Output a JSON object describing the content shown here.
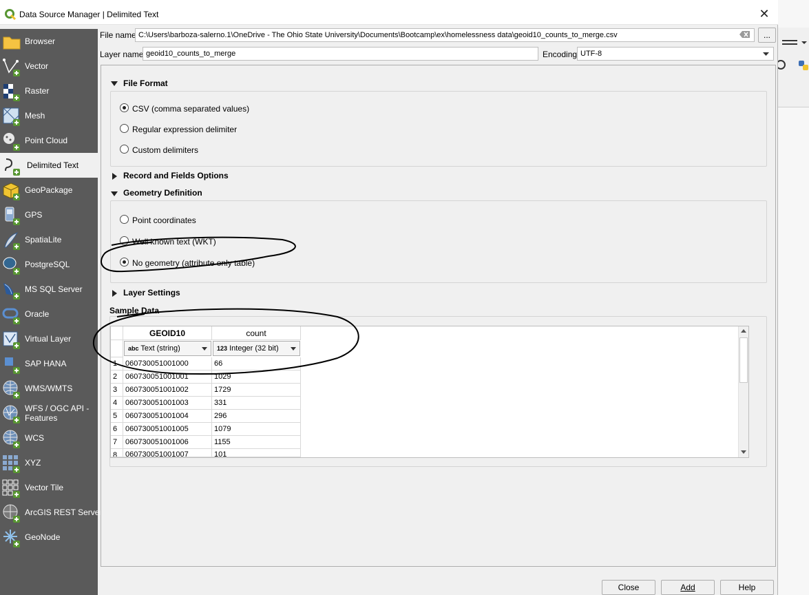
{
  "window": {
    "title": "Data Source Manager | Delimited Text",
    "close_glyph": "✕"
  },
  "sidebar": {
    "items": [
      {
        "label": "Browser",
        "icon": "folder-icon"
      },
      {
        "label": "Vector",
        "icon": "vector-icon"
      },
      {
        "label": "Raster",
        "icon": "raster-icon"
      },
      {
        "label": "Mesh",
        "icon": "mesh-icon"
      },
      {
        "label": "Point Cloud",
        "icon": "point-cloud-icon"
      },
      {
        "label": "Delimited Text",
        "icon": "delimited-text-icon",
        "active": true
      },
      {
        "label": "GeoPackage",
        "icon": "geopackage-icon"
      },
      {
        "label": "GPS",
        "icon": "gps-icon"
      },
      {
        "label": "SpatiaLite",
        "icon": "spatialite-icon"
      },
      {
        "label": "PostgreSQL",
        "icon": "postgresql-icon"
      },
      {
        "label": "MS SQL Server",
        "icon": "mssql-icon"
      },
      {
        "label": "Oracle",
        "icon": "oracle-icon"
      },
      {
        "label": "Virtual Layer",
        "icon": "virtual-layer-icon"
      },
      {
        "label": "SAP HANA",
        "icon": "sap-hana-icon"
      },
      {
        "label": "WMS/WMTS",
        "icon": "wms-icon"
      },
      {
        "label_line1": "WFS / OGC API -",
        "label_line2": "Features",
        "icon": "wfs-icon"
      },
      {
        "label": "WCS",
        "icon": "wcs-icon"
      },
      {
        "label": "XYZ",
        "icon": "xyz-icon"
      },
      {
        "label": "Vector Tile",
        "icon": "vector-tile-icon"
      },
      {
        "label": "ArcGIS REST Server",
        "icon": "arcgis-icon"
      },
      {
        "label": "GeoNode",
        "icon": "geonode-icon"
      }
    ]
  },
  "form": {
    "file_name_label": "File name",
    "file_name_value": "C:\\Users\\barboza-salerno.1\\OneDrive - The Ohio State University\\Documents\\Bootcamp\\ex\\homelessness data\\geoid10_counts_to_merge.csv",
    "browse_label": "...",
    "layer_name_label": "Layer name",
    "layer_name_value": "geoid10_counts_to_merge",
    "encoding_label": "Encoding",
    "encoding_value": "UTF-8"
  },
  "file_format": {
    "title": "File Format",
    "options": [
      "CSV (comma separated values)",
      "Regular expression delimiter",
      "Custom delimiters"
    ],
    "selected": 0
  },
  "record_fields": {
    "title": "Record and Fields Options"
  },
  "geometry": {
    "title": "Geometry Definition",
    "options": [
      "Point coordinates",
      "Well known text (WKT)",
      "No geometry (attribute only table)"
    ],
    "selected": 2
  },
  "layer_settings": {
    "title": "Layer Settings"
  },
  "sample": {
    "title": "Sample Data",
    "columns": [
      {
        "name": "GEOID10",
        "type_badge": "abc",
        "type": "Text (string)"
      },
      {
        "name": "count",
        "type_badge": "123",
        "type": "Integer (32 bit)"
      }
    ],
    "rows": [
      [
        "1",
        "060730051001000",
        "66"
      ],
      [
        "2",
        "060730051001001",
        "1029"
      ],
      [
        "3",
        "060730051001002",
        "1729"
      ],
      [
        "4",
        "060730051001003",
        "331"
      ],
      [
        "5",
        "060730051001004",
        "296"
      ],
      [
        "6",
        "060730051001005",
        "1079"
      ],
      [
        "7",
        "060730051001006",
        "1155"
      ],
      [
        "8",
        "060730051001007",
        "101"
      ]
    ]
  },
  "buttons": {
    "close": "Close",
    "add": "Add",
    "help": "Help"
  },
  "colors": {
    "sidebar_bg": "#5a5a5a",
    "active_item_bg": "#f0f0f0",
    "qgis_green": "#589632",
    "qgis_yellow": "#f0c431"
  }
}
